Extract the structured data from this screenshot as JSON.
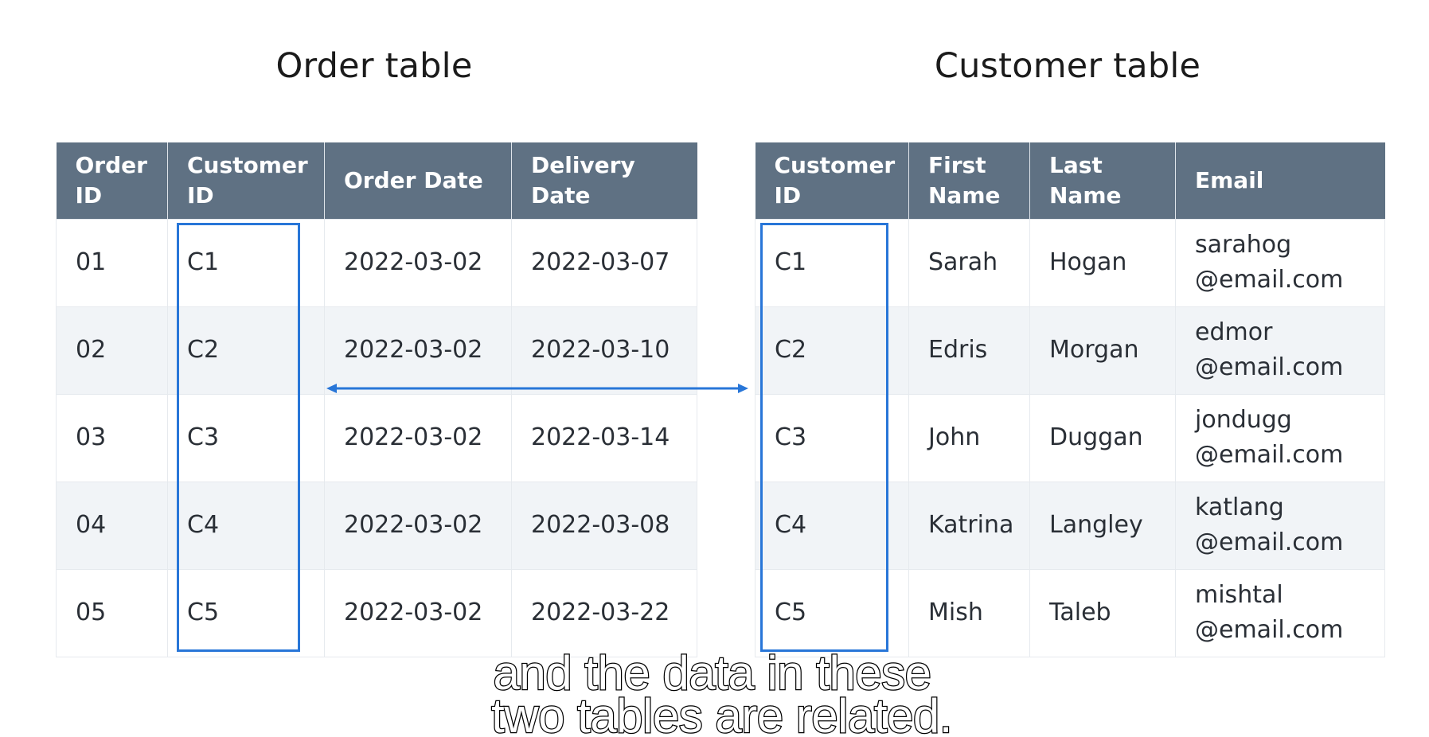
{
  "order_table": {
    "title": "Order table",
    "columns": [
      "Order\nID",
      "Customer\nID",
      "Order Date",
      "Delivery\nDate"
    ],
    "rows": [
      [
        "01",
        "C1",
        "2022-03-02",
        "2022-03-07"
      ],
      [
        "02",
        "C2",
        "2022-03-02",
        "2022-03-10"
      ],
      [
        "03",
        "C3",
        "2022-03-02",
        "2022-03-14"
      ],
      [
        "04",
        "C4",
        "2022-03-02",
        "2022-03-08"
      ],
      [
        "05",
        "C5",
        "2022-03-02",
        "2022-03-22"
      ]
    ]
  },
  "customer_table": {
    "title": "Customer table",
    "columns": [
      "Customer\nID",
      "First\nName",
      "Last\nName",
      "Email"
    ],
    "rows": [
      [
        "C1",
        "Sarah",
        "Hogan",
        "sarahog\n@email.com"
      ],
      [
        "C2",
        "Edris",
        "Morgan",
        "edmor\n@email.com"
      ],
      [
        "C3",
        "John",
        "Duggan",
        "jondugg\n@email.com"
      ],
      [
        "C4",
        "Katrina",
        "Langley",
        "katlang\n@email.com"
      ],
      [
        "C5",
        "Mish",
        "Taleb",
        "mishtal\n@email.com"
      ]
    ]
  },
  "colors": {
    "header_bg": "#5f7183",
    "highlight": "#2876d8",
    "alt_row": "#f1f4f7"
  },
  "caption": {
    "line1": "and the data in these",
    "line2": "two tables are related."
  }
}
